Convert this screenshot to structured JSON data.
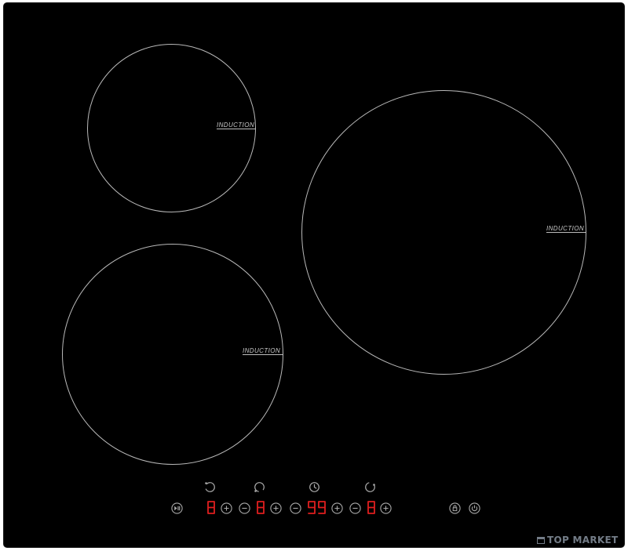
{
  "cooktop": {
    "zones": [
      {
        "id": "rear-left",
        "label": "INDUCTION"
      },
      {
        "id": "right",
        "label": "INDUCTION"
      },
      {
        "id": "front-left",
        "label": "INDUCTION"
      }
    ]
  },
  "control_panel": {
    "zone_indicators": [
      "rear-left-zone-icon",
      "front-left-zone-icon",
      "timer-icon",
      "right-zone-icon"
    ],
    "displays": {
      "zone_1": "8",
      "zone_2": "8",
      "timer": "99",
      "zone_3": "8"
    },
    "display_color": "#e01e1e",
    "icon_color": "#a9a9a9",
    "buttons": [
      "pause-play",
      "minus",
      "plus",
      "minus",
      "plus",
      "minus",
      "plus",
      "minus",
      "plus",
      "lock",
      "power"
    ]
  },
  "watermark": {
    "text": "TOP MARKET"
  }
}
